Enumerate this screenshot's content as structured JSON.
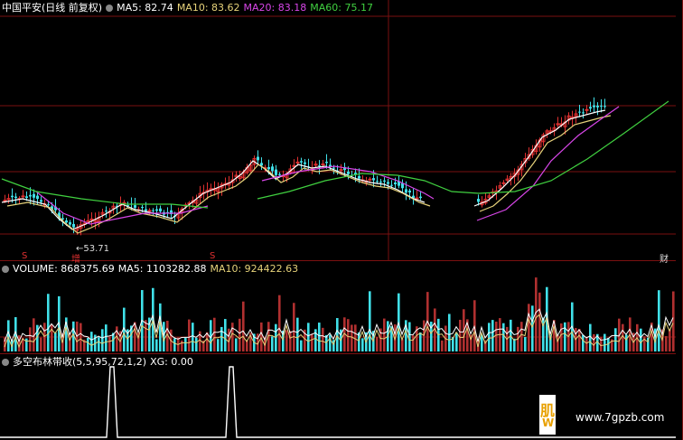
{
  "main_panel": {
    "stock": "中国平安(日线 前复权)",
    "ma5": "MA5: 82.74",
    "ma10": "MA10: 83.62",
    "ma20": "MA20: 83.18",
    "ma60": "MA60: 75.17",
    "low_label": "←53.71",
    "markers": [
      "S",
      "增",
      "S",
      "财"
    ]
  },
  "volume_panel": {
    "volume": "VOLUME: 868375.69",
    "ma5": "MA5: 1103282.88",
    "ma10": "MA10: 924422.63"
  },
  "indicator_panel": {
    "name": "多空布林带收(5,5,95,72,1,2)",
    "xg": "XG: 0.00"
  },
  "watermark": {
    "glyph_top": "肌",
    "glyph_bottom": "W",
    "url": "www.7gpzb.com"
  },
  "colors": {
    "up": "#e03030",
    "down": "#40e0e8",
    "ma5": "#ffffff",
    "ma10": "#e6d27a",
    "ma20": "#d846e8",
    "ma60": "#40d040",
    "grid": "#7a1010"
  }
}
